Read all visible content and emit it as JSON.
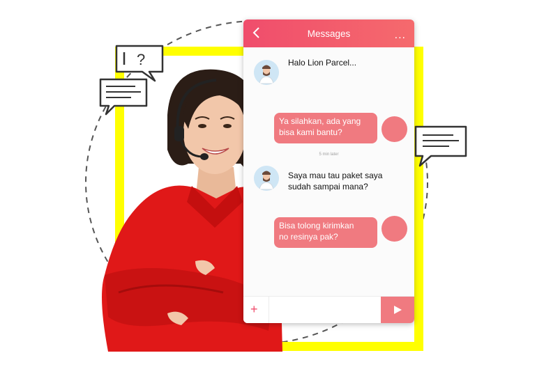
{
  "header": {
    "title": "Messages",
    "back_icon": "chevron-left-icon",
    "more_icon": "more-dots-icon",
    "more_label": "..."
  },
  "messages": [
    {
      "from": "agent",
      "text": "Halo Lion Parcel..."
    },
    {
      "from": "me",
      "line1": "Ya silahkan, ada yang",
      "line2": "bisa kami bantu?"
    },
    {
      "from": "agent",
      "line1": "Saya mau tau paket saya",
      "line2": "sudah sampai mana?"
    },
    {
      "from": "me",
      "line1": "Bisa tolong kirimkan",
      "line2": "no resinya pak?"
    }
  ],
  "time_label": "5 min later",
  "composer": {
    "plus_label": "+",
    "send_icon": "send-icon"
  },
  "colors": {
    "accent": "#f04d6c",
    "bubble": "#f07a80",
    "frame": "#ffff00",
    "shirt": "#e01818"
  }
}
